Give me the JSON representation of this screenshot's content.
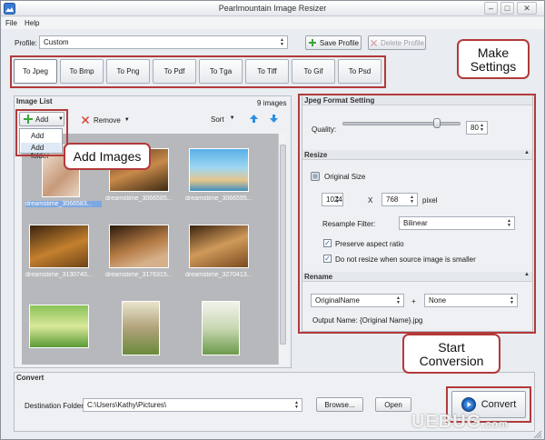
{
  "window": {
    "title": "Pearlmountain Image Resizer"
  },
  "menu": {
    "file": "File",
    "help": "Help"
  },
  "profile": {
    "label": "Profile:",
    "value": "Custom",
    "save": "Save Profile",
    "delete": "Delete Profile"
  },
  "tabs": [
    "To Jpeg",
    "To Bmp",
    "To Png",
    "To Pdf",
    "To Tga",
    "To Tiff",
    "To Gif",
    "To Psd"
  ],
  "image_list": {
    "title": "Image List",
    "count": "9 images",
    "add": "Add",
    "remove": "Remove",
    "sort": "Sort",
    "dropdown": [
      "Add",
      "Add folder"
    ],
    "captions": [
      "dreamstime_3066583...",
      "dreamstime_3066585...",
      "dreamstime_3066595...",
      "dreamstime_3130740...",
      "dreamstime_3176315...",
      "dreamstime_3270413...",
      "",
      "",
      ""
    ]
  },
  "format": {
    "title": "Jpeg Format Setting",
    "quality_label": "Quality:",
    "quality_value": "80",
    "quality_percent": 80
  },
  "resize": {
    "title": "Resize",
    "original_size": "Original Size",
    "width": "1024",
    "x": "X",
    "height": "768",
    "unit": "pixel",
    "filter_label": "Resample Filter:",
    "filter_value": "Bilinear",
    "aspect": "Preserve aspect ratio",
    "no_upscale": "Do not resize when source image is smaller"
  },
  "rename": {
    "title": "Rename",
    "name_value": "OriginalName",
    "plus": "+",
    "suffix_value": "None",
    "output_label": "Output Name:",
    "output_value": "{Original Name}.jpg"
  },
  "convert": {
    "title": "Convert",
    "dest_label": "Destination Folder:",
    "dest_value": "C:\\Users\\Kathy\\Pictures\\",
    "browse": "Browse...",
    "open": "Open",
    "button": "Convert"
  },
  "callouts": {
    "add_images": "Add Images",
    "make_settings_1": "Make",
    "make_settings_2": "Settings",
    "start_1": "Start",
    "start_2": "Conversion"
  },
  "watermark": "UEBUG",
  "watermark_suffix": ".com",
  "colors": {
    "accent_red": "#b23a3a",
    "convert_blue": "#1f5fb0",
    "add_green": "#3aa33a",
    "remove_red": "#d23a2a"
  }
}
